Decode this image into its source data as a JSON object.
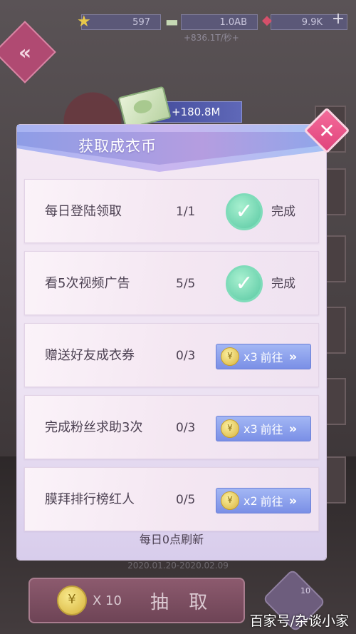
{
  "top_bar": {
    "star_count": "597",
    "cash_count": "1.0AB",
    "gem_count": "9.9K",
    "rate_text": "+836.1T/秒+",
    "plus_label": "+"
  },
  "back_button": {
    "icon": "chevron-double-left-icon",
    "label": "«"
  },
  "reward_banner": {
    "amount": "+180.8M"
  },
  "dialog": {
    "title": "获取成衣币",
    "close_label": "✕",
    "tasks": [
      {
        "name": "每日登陆领取",
        "progress": "1/1",
        "status": "done",
        "status_label": "完成"
      },
      {
        "name": "看5次视频广告",
        "progress": "5/5",
        "status": "done",
        "status_label": "完成"
      },
      {
        "name": "赠送好友成衣券",
        "progress": "0/3",
        "status": "go",
        "multiplier": "x3",
        "action_label": "前往"
      },
      {
        "name": "完成粉丝求助3次",
        "progress": "0/3",
        "status": "go",
        "multiplier": "x3",
        "action_label": "前往"
      },
      {
        "name": "膜拜排行榜红人",
        "progress": "0/5",
        "status": "go",
        "multiplier": "x2",
        "action_label": "前往"
      }
    ],
    "refresh_note": "每日0点刷新"
  },
  "bottom": {
    "date_range": "2020.01.20-2020.02.09",
    "draw_cost": "X 10",
    "draw_label": "抽 取",
    "side_count": "10"
  },
  "watermark": "百家号/杂谈小家",
  "colors": {
    "accent_blue": "#7a8fe6",
    "done_green": "#58c8a2",
    "close_pink": "#e0437c"
  }
}
